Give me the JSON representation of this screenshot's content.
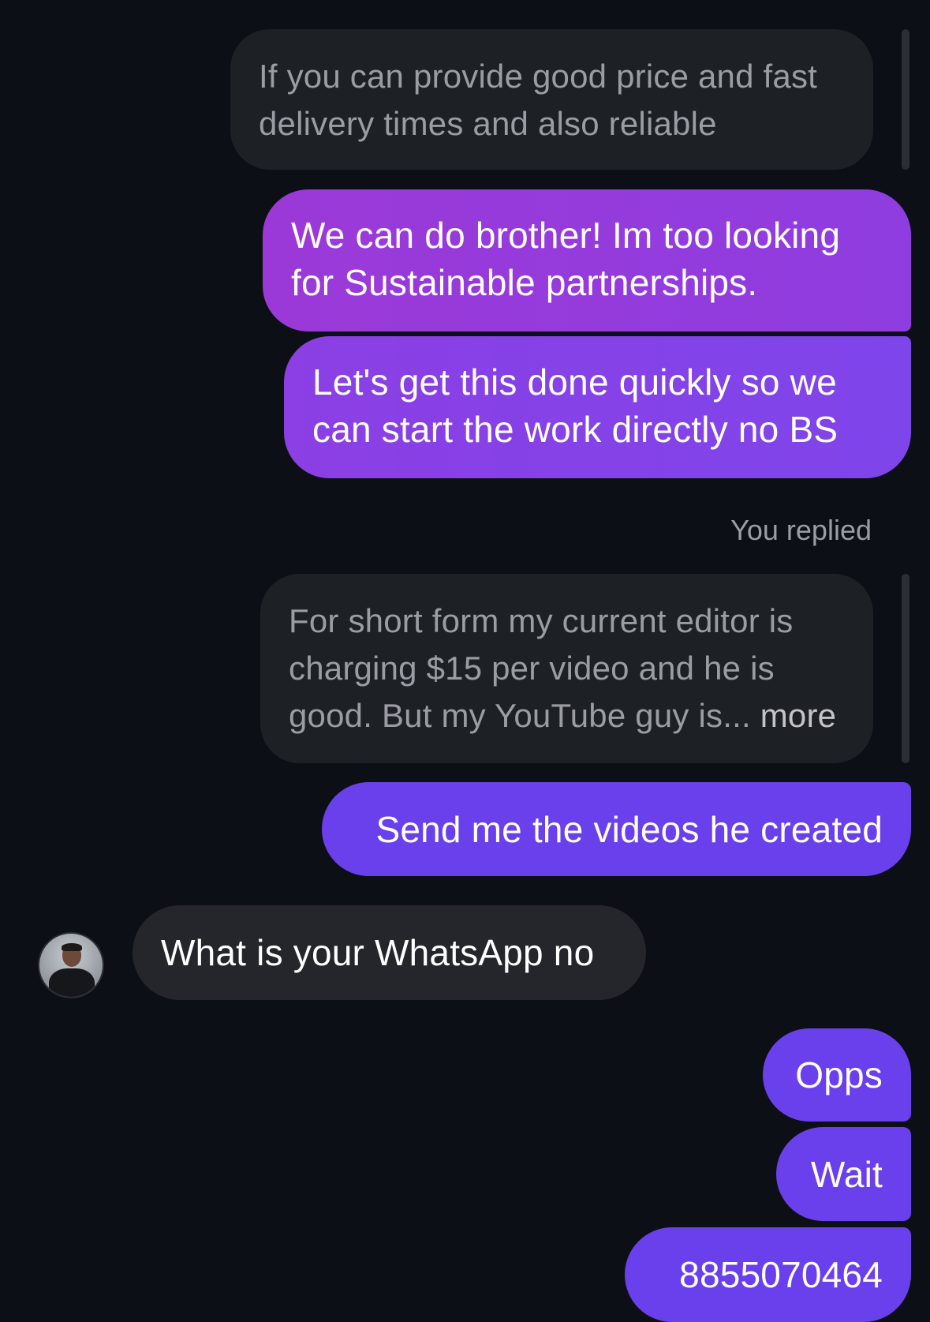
{
  "conversation": {
    "messages": [
      {
        "kind": "replied-reference",
        "lines": [
          "If you can provide good price and fast",
          "delivery times and also reliable"
        ]
      },
      {
        "kind": "outgoing",
        "lines": [
          "We can do brother! Im too looking",
          "for Sustainable partnerships."
        ]
      },
      {
        "kind": "outgoing",
        "lines": [
          "Let's get this done quickly so we",
          "can start the work directly no BS"
        ]
      },
      {
        "kind": "replied-reference",
        "lines": [
          "For short form my current editor is",
          "charging $15 per video and he is",
          "good. But my YouTube guy is..."
        ],
        "more_label": "more"
      },
      {
        "kind": "outgoing",
        "text": "Send me the videos he created"
      },
      {
        "kind": "incoming",
        "text": "What is your WhatsApp no",
        "avatar_icon": "person-avatar"
      },
      {
        "kind": "outgoing",
        "text": "Opps"
      },
      {
        "kind": "outgoing",
        "text": "Wait"
      },
      {
        "kind": "outgoing",
        "text": "8855070464"
      }
    ],
    "replied_label": "You replied"
  },
  "colors": {
    "background": "#0c1016",
    "reply_bubble": "#1d2025",
    "incoming_bubble": "#24262b",
    "outgoing_purple_top": "#9b39d8",
    "outgoing_purple_bottom": "#6a40ec"
  }
}
